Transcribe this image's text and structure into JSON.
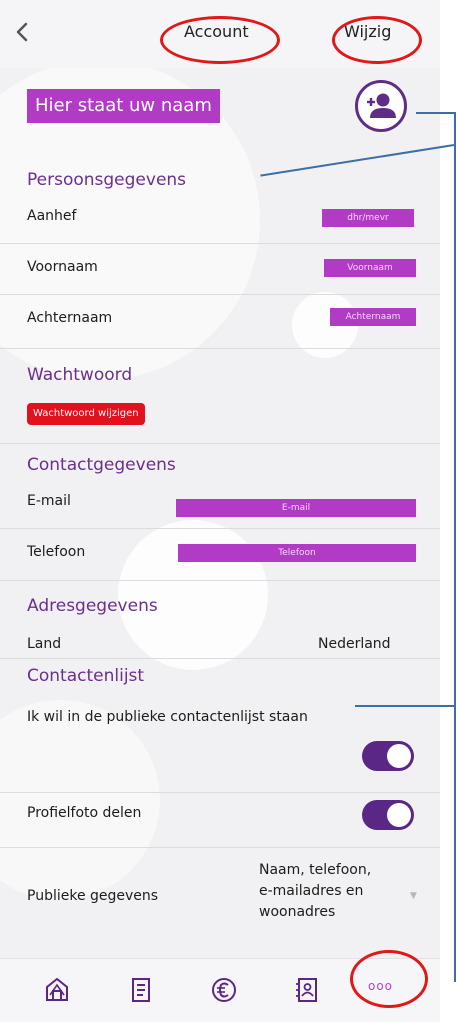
{
  "header": {
    "title": "Account",
    "edit_label": "Wijzig"
  },
  "profile": {
    "name_placeholder": "Hier staat uw naam",
    "avatar_icon": "add-user-icon"
  },
  "persoonsgegevens": {
    "title": "Persoonsgegevens",
    "rows": [
      {
        "label": "Aanhef",
        "value": "dhr/mevr"
      },
      {
        "label": "Voornaam",
        "value": "Voornaam"
      },
      {
        "label": "Achternaam",
        "value": "Achternaam"
      }
    ]
  },
  "wachtwoord": {
    "title": "Wachtwoord",
    "button_label": "Wachtwoord wijzigen"
  },
  "contactgegevens": {
    "title": "Contactgegevens",
    "rows": [
      {
        "label": "E-mail",
        "value": "E-mail"
      },
      {
        "label": "Telefoon",
        "value": "Telefoon"
      }
    ]
  },
  "adresgegevens": {
    "title": "Adresgegevens",
    "land_label": "Land",
    "land_value": "Nederland"
  },
  "contactenlijst": {
    "title": "Contactenlijst",
    "public_list_label": "Ik wil in de publieke contactenlijst staan",
    "public_list_on": true,
    "photo_label": "Profielfoto delen",
    "photo_on": true,
    "public_data_label": "Publieke gegevens",
    "public_data_value": "Naam, telefoon, e-mailadres en woonadres"
  },
  "bottom_nav": {
    "items": [
      "home-icon",
      "document-icon",
      "euro-icon",
      "contacts-icon",
      "more-icon"
    ],
    "more_glyph": "ooo"
  },
  "colors": {
    "accent_purple": "#b23bc6",
    "dark_purple": "#5a2787",
    "section_title": "#6a2f8f",
    "danger_red": "#e3101e",
    "annotation_ring": "#e01818",
    "annotation_line": "#3b6fa6"
  }
}
